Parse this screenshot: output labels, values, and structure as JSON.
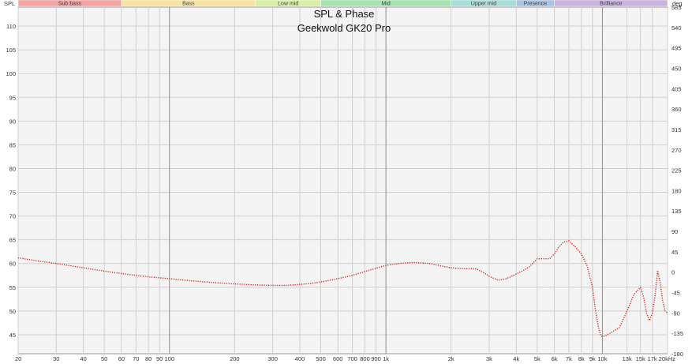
{
  "chart_data": {
    "type": "line",
    "title": "SPL & Phase",
    "subtitle": "Geekwold GK20 Pro",
    "ylabel": "SPL",
    "y2label": "deg",
    "x_scale": "log",
    "xlim": [
      20,
      20000
    ],
    "ylim": [
      41,
      114
    ],
    "y2lim": [
      -180,
      585
    ],
    "grid": true,
    "bands": [
      {
        "label": "Sub bass",
        "from": 20,
        "to": 60,
        "color": "#f4a3a3"
      },
      {
        "label": "Bass",
        "from": 60,
        "to": 250,
        "color": "#f7e3a1"
      },
      {
        "label": "Low mid",
        "from": 250,
        "to": 500,
        "color": "#d9efa8"
      },
      {
        "label": "Mid",
        "from": 500,
        "to": 2000,
        "color": "#a6e3ae"
      },
      {
        "label": "Upper mid",
        "from": 2000,
        "to": 4000,
        "color": "#a6ddd6"
      },
      {
        "label": "Presence",
        "from": 4000,
        "to": 6000,
        "color": "#a8c4e3"
      },
      {
        "label": "Brilliance",
        "from": 6000,
        "to": 20000,
        "color": "#c7b3de"
      }
    ],
    "x_ticks": [
      {
        "v": 20,
        "t": "20"
      },
      {
        "v": 30,
        "t": "30"
      },
      {
        "v": 40,
        "t": "40"
      },
      {
        "v": 50,
        "t": "50"
      },
      {
        "v": 60,
        "t": "60"
      },
      {
        "v": 70,
        "t": "70"
      },
      {
        "v": 80,
        "t": "80"
      },
      {
        "v": 90,
        "t": "90"
      },
      {
        "v": 100,
        "t": "100"
      },
      {
        "v": 200,
        "t": "200"
      },
      {
        "v": 300,
        "t": "300"
      },
      {
        "v": 400,
        "t": "400"
      },
      {
        "v": 500,
        "t": "500"
      },
      {
        "v": 600,
        "t": "600"
      },
      {
        "v": 700,
        "t": "700"
      },
      {
        "v": 800,
        "t": "800"
      },
      {
        "v": 900,
        "t": "900"
      },
      {
        "v": 1000,
        "t": "1k"
      },
      {
        "v": 2000,
        "t": "2k"
      },
      {
        "v": 3000,
        "t": "3k"
      },
      {
        "v": 4000,
        "t": "4k"
      },
      {
        "v": 5000,
        "t": "5k"
      },
      {
        "v": 6000,
        "t": "6k"
      },
      {
        "v": 7000,
        "t": "7k"
      },
      {
        "v": 8000,
        "t": "8k"
      },
      {
        "v": 9000,
        "t": "9k"
      },
      {
        "v": 10000,
        "t": "10k"
      },
      {
        "v": 13000,
        "t": "13k"
      },
      {
        "v": 15000,
        "t": "15k"
      },
      {
        "v": 17000,
        "t": "17k"
      },
      {
        "v": 20000,
        "t": "20kHz"
      }
    ],
    "y_ticks": [
      45,
      50,
      55,
      60,
      65,
      70,
      75,
      80,
      85,
      90,
      95,
      100,
      105,
      110
    ],
    "y2_ticks": [
      -180,
      -135,
      -90,
      -45,
      0,
      45,
      90,
      135,
      180,
      225,
      270,
      315,
      360,
      405,
      450,
      495,
      540,
      585
    ],
    "series": [
      {
        "color": "#d42020",
        "x": [
          20,
          25,
          30,
          40,
          50,
          60,
          70,
          80,
          100,
          130,
          160,
          200,
          250,
          300,
          350,
          400,
          450,
          500,
          600,
          700,
          800,
          900,
          1000,
          1100,
          1200,
          1300,
          1400,
          1600,
          1800,
          2000,
          2300,
          2600,
          2800,
          3000,
          3300,
          3600,
          4000,
          4300,
          4600,
          5000,
          5300,
          5700,
          6000,
          6300,
          6600,
          7000,
          7500,
          8000,
          8500,
          9000,
          9300,
          9600,
          9800,
          10000,
          10500,
          11000,
          12000,
          13000,
          14000,
          15000,
          15500,
          16000,
          16500,
          17000,
          17500,
          18000,
          18500,
          19000,
          19500,
          20000
        ],
        "y": [
          61.2,
          60.5,
          60.0,
          59.1,
          58.4,
          57.9,
          57.5,
          57.2,
          56.8,
          56.3,
          56.0,
          55.7,
          55.5,
          55.4,
          55.4,
          55.6,
          55.8,
          56.1,
          56.8,
          57.5,
          58.3,
          59.0,
          59.6,
          59.9,
          60.1,
          60.2,
          60.2,
          60.0,
          59.5,
          59.1,
          58.9,
          58.9,
          58.2,
          57.3,
          56.5,
          56.8,
          57.8,
          58.5,
          59.3,
          61.0,
          61.0,
          61.0,
          62.0,
          63.5,
          64.5,
          64.8,
          63.5,
          62.0,
          59.5,
          55.0,
          50.0,
          46.5,
          45.0,
          44.6,
          44.9,
          45.5,
          46.5,
          50.0,
          53.5,
          55.0,
          53.0,
          49.5,
          48.0,
          49.5,
          53.0,
          58.5,
          56.0,
          52.0,
          50.0,
          49.5
        ]
      }
    ]
  }
}
